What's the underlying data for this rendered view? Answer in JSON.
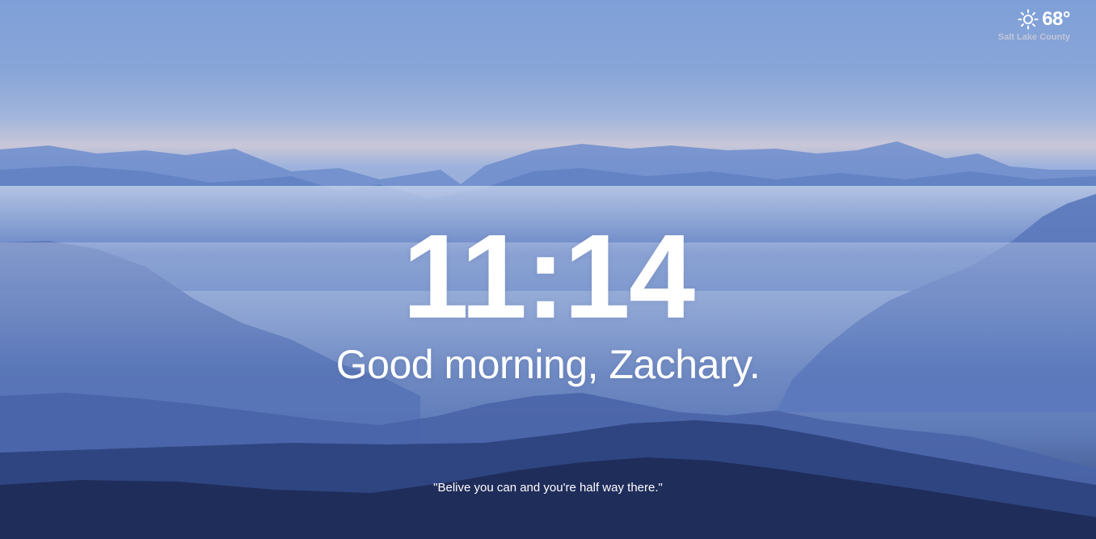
{
  "weather": {
    "icon": "sun-icon",
    "temperature": "68°",
    "location": "Salt Lake County"
  },
  "clock": {
    "time": "11:14"
  },
  "greeting": {
    "text": "Good morning, Zachary."
  },
  "quote": {
    "text": "\"Belive you can and you're half way there.\""
  },
  "colors": {
    "sky_top": "#7e9fd8",
    "horizon_glow": "#c9c7d8",
    "mountain_dark": "#1f2d5a",
    "text": "#ffffff"
  }
}
